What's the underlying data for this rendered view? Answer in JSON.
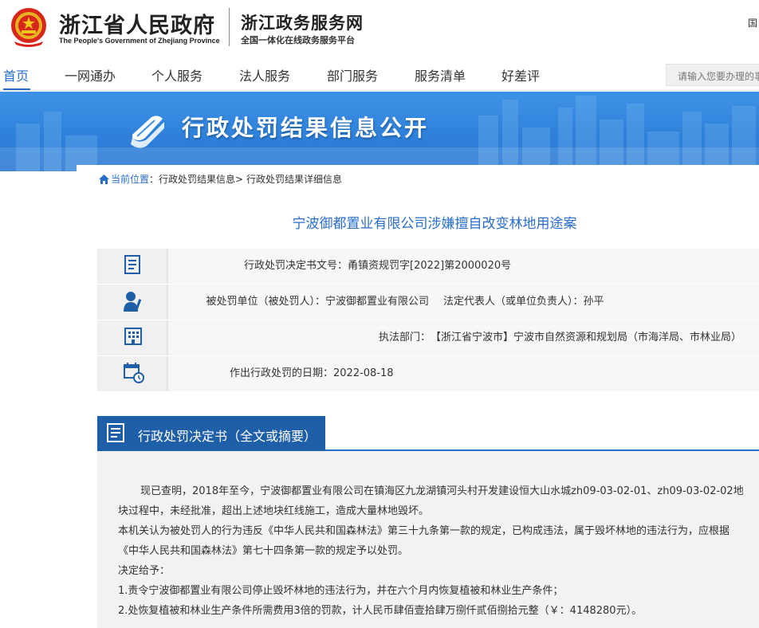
{
  "header": {
    "gov_title": "浙江省人民政府",
    "gov_subtitle": "The People's Government of Zhejiang Province",
    "service_title": "浙江政务服务网",
    "service_subtitle": "全国一体化在线政务服务平台",
    "right_text": "国"
  },
  "nav": {
    "items": [
      "首页",
      "一网通办",
      "个人服务",
      "法人服务",
      "部门服务",
      "服务清单",
      "好差评"
    ],
    "active": "首页",
    "search_placeholder": "请输入您要办理的事"
  },
  "banner": {
    "title": "行政处罚结果信息公开"
  },
  "breadcrumb": {
    "home": "当前位置",
    "sep": "：",
    "level1": "行政处罚结果信息",
    "level2": "行政处罚结果详细信息",
    "arrow": ">"
  },
  "case": {
    "title": "宁波御都置业有限公司涉嫌擅自改变林地用途案",
    "rows": [
      {
        "icon": "document-icon",
        "label": "行政处罚决定书文号：",
        "value": "甬镇资规罚字[2022]第2000020号"
      },
      {
        "icon": "person-icon",
        "label": "被处罚单位（被处罚人）：",
        "value": "宁波御都置业有限公司",
        "label2": "法定代表人（或单位负责人）：",
        "value2": "孙平"
      },
      {
        "icon": "building-icon",
        "label": "执法部门：",
        "value": "【浙江省宁波市】宁波市自然资源和规划局（市海洋局、市林业局）"
      },
      {
        "icon": "calendar-icon",
        "label": "作出行政处罚的日期：",
        "value": "2022-08-18"
      }
    ]
  },
  "decision": {
    "tab_label": "行政处罚决定书（全文或摘要）",
    "paragraph1": "现已查明，2018年至今，宁波御都置业有限公司在镇海区九龙湖镇河头村开发建设恒大山水城zh09-03-02-01、zh09-03-02-02地块过程中，未经批准，超出上述地块红线施工，造成大量林地毁坏。",
    "paragraph2": "本机关认为被处罚人的行为违反《中华人民共和国森林法》第三十九条第一款的规定，已构成违法，属于毁坏林地的违法行为，应根据《中华人民共和国森林法》第七十四条第一款的规定予以处罚。",
    "paragraph3": "决定给予：",
    "item1": "1.责令宁波御都置业有限公司停止毁坏林地的违法行为，并在六个月内恢复植被和林业生产条件；",
    "item2": "2.处恢复植被和林业生产条件所需费用3倍的罚款，计人民币肆佰壹拾肆万捌仟贰佰捌拾元整（￥：4148280元）。"
  },
  "colors": {
    "accent": "#2a6ecb",
    "tab": "#1f5fa8",
    "banner": "#3f93e6"
  }
}
